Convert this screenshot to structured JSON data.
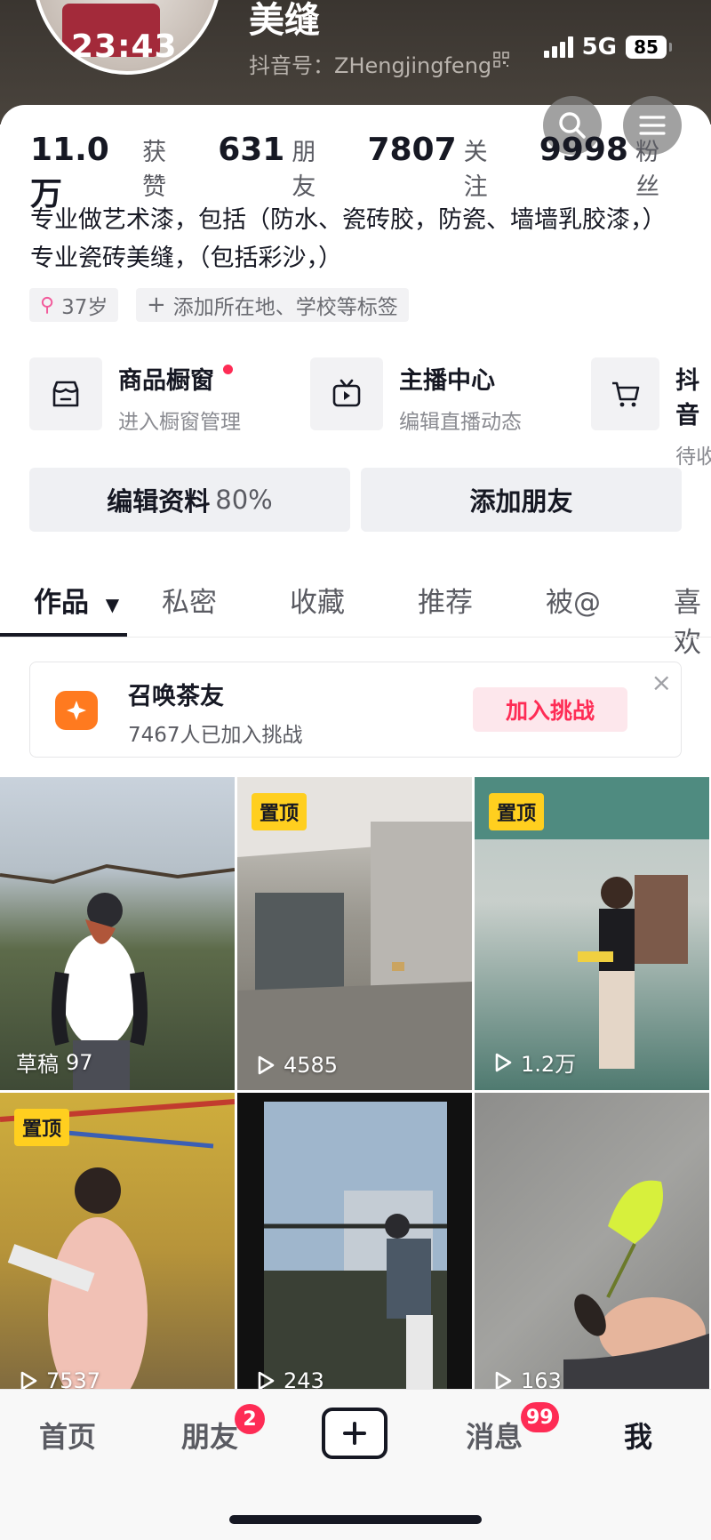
{
  "status_bar": {
    "time": "23:43",
    "network": "5G",
    "battery": "85"
  },
  "profile": {
    "name": "美缝",
    "douyin_id": "抖音号：ZHengjingfeng",
    "stats": [
      {
        "value": "11.0万",
        "label": "获赞"
      },
      {
        "value": "631",
        "label": "朋友"
      },
      {
        "value": "7807",
        "label": "关注"
      },
      {
        "value": "9998",
        "label": "粉丝"
      }
    ],
    "bio": "专业做艺术漆，包括（防水、瓷砖胶，防瓷、墙墙乳胶漆，）专业瓷砖美缝，（包括彩沙，）",
    "tags": {
      "age": "37岁",
      "add": "添加所在地、学校等标签"
    }
  },
  "features": [
    {
      "title": "商品橱窗",
      "sub": "进入橱窗管理",
      "icon": "shop-icon"
    },
    {
      "title": "主播中心",
      "sub": "编辑直播动态",
      "icon": "live-tv-icon"
    },
    {
      "title": "抖音",
      "sub": "待收",
      "icon": "cart-icon"
    }
  ],
  "actions": {
    "edit": "编辑资料",
    "edit_pct": "80%",
    "add_friend": "添加朋友"
  },
  "tabs": [
    "作品",
    "私密",
    "收藏",
    "推荐",
    "被@",
    "喜欢"
  ],
  "challenge": {
    "title": "召唤茶友",
    "sub": "7467人已加入挑战",
    "button": "加入挑战",
    "close": "×"
  },
  "videos": [
    {
      "pin": "",
      "prefix": "草稿",
      "count": "97",
      "play": false
    },
    {
      "pin": "置顶",
      "prefix": "",
      "count": "4585",
      "play": true
    },
    {
      "pin": "置顶",
      "prefix": "",
      "count": "1.2万",
      "play": true
    },
    {
      "pin": "置顶",
      "prefix": "",
      "count": "7537",
      "play": true
    },
    {
      "pin": "",
      "prefix": "",
      "count": "243",
      "play": true
    },
    {
      "pin": "",
      "prefix": "",
      "count": "163",
      "play": true
    }
  ],
  "tabbar": {
    "home": "首页",
    "friends": "朋友",
    "friends_badge": "2",
    "messages": "消息",
    "messages_badge": "99",
    "me": "我"
  }
}
